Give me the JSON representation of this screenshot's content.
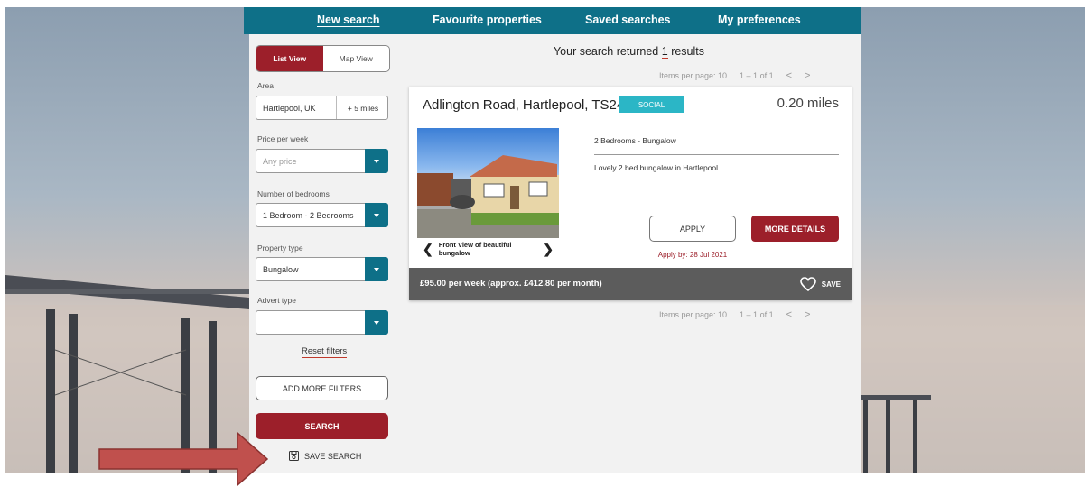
{
  "nav": {
    "items": [
      {
        "label": "New search"
      },
      {
        "label": "Favourite properties"
      },
      {
        "label": "Saved searches"
      },
      {
        "label": "My preferences"
      }
    ]
  },
  "sidebar": {
    "view_toggle": {
      "list": "List View",
      "map": "Map View",
      "active": "List View"
    },
    "area": {
      "label": "Area",
      "value": "Hartlepool, UK",
      "radius": "+ 5 miles"
    },
    "price": {
      "label": "Price per week",
      "placeholder": "Any price"
    },
    "bedrooms": {
      "label": "Number of bedrooms",
      "value": "1 Bedroom - 2 Bedrooms"
    },
    "property_type": {
      "label": "Property type",
      "value": "Bungalow"
    },
    "advert_type": {
      "label": "Advert type",
      "value": ""
    },
    "reset_label": "Reset filters",
    "add_filters_label": "ADD MORE FILTERS",
    "search_label": "SEARCH",
    "save_search_label": "SAVE SEARCH"
  },
  "results": {
    "prefix": "Your search returned",
    "count": "1",
    "suffix": "results",
    "pager_top": {
      "per_page": "Items per page: 10",
      "range": "1 – 1 of 1",
      "prev": "<",
      "next": ">"
    },
    "pager_bottom": {
      "per_page": "Items per page: 10",
      "range": "1 – 1 of 1",
      "prev": "<",
      "next": ">"
    }
  },
  "listing": {
    "title": "Adlington Road, Hartlepool, TS24",
    "badge": "SOCIAL",
    "distance": "0.20 miles",
    "caption": "Front View of beautiful bungalow",
    "caption_prev": "❮",
    "caption_next": "❯",
    "spec": "2 Bedrooms - Bungalow",
    "description": "Lovely 2 bed bungalow in Hartlepool",
    "apply_label": "APPLY",
    "details_label": "MORE DETAILS",
    "apply_by": "Apply by: 28 Jul 2021",
    "price": "£95.00 per week (approx. £412.80 per month)",
    "save_label": "SAVE"
  },
  "colors": {
    "brand_teal": "#0e7088",
    "brand_red": "#9c1f2a",
    "badge_teal": "#2bb6c6",
    "arrow_red": "#c0504d"
  }
}
